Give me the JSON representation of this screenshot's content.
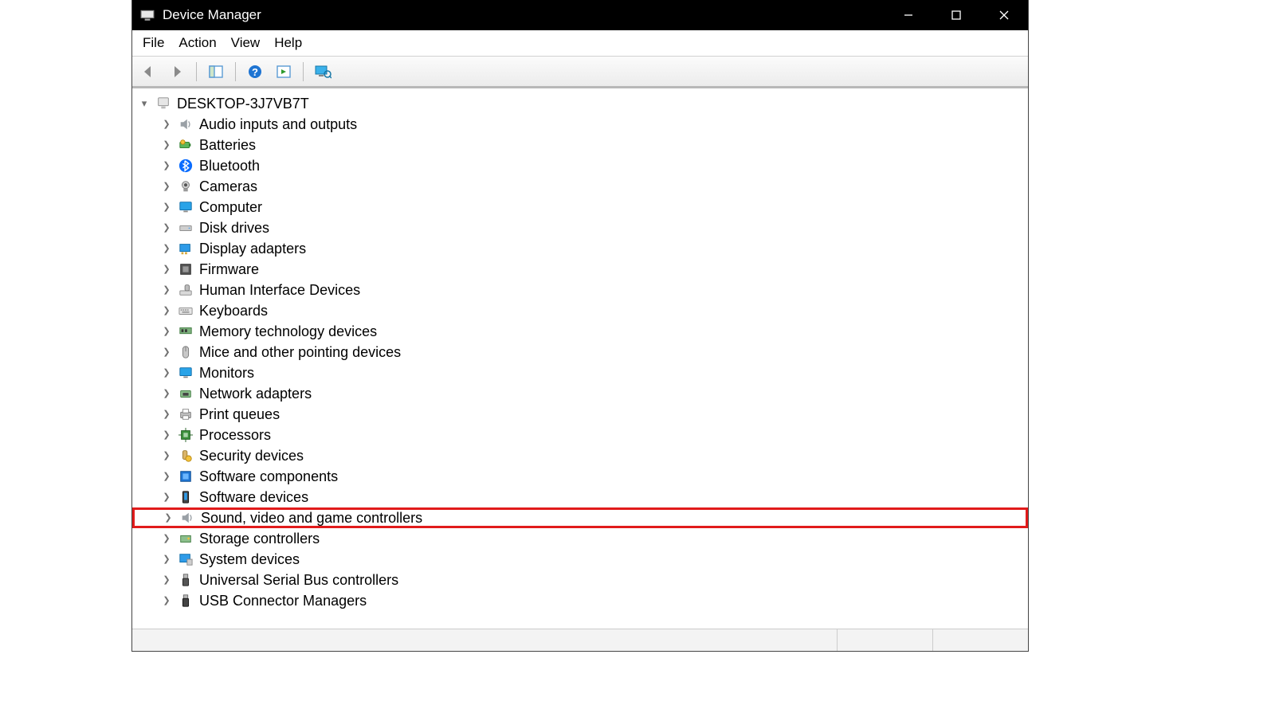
{
  "window": {
    "title": "Device Manager"
  },
  "menubar": {
    "items": [
      "File",
      "Action",
      "View",
      "Help"
    ]
  },
  "toolbar": {
    "items": [
      {
        "name": "back-icon"
      },
      {
        "name": "forward-icon"
      },
      {
        "name": "show-hide-tree-icon"
      },
      {
        "name": "help-icon"
      },
      {
        "name": "action-icon"
      },
      {
        "name": "scan-hardware-icon"
      }
    ]
  },
  "tree": {
    "root": {
      "label": "DESKTOP-3J7VB7T",
      "expanded": true,
      "icon": "computer-icon"
    },
    "categories": [
      {
        "label": "Audio inputs and outputs",
        "icon": "speaker-icon",
        "highlighted": false
      },
      {
        "label": "Batteries",
        "icon": "battery-icon",
        "highlighted": false
      },
      {
        "label": "Bluetooth",
        "icon": "bluetooth-icon",
        "highlighted": false
      },
      {
        "label": "Cameras",
        "icon": "camera-icon",
        "highlighted": false
      },
      {
        "label": "Computer",
        "icon": "monitor-icon",
        "highlighted": false
      },
      {
        "label": "Disk drives",
        "icon": "disk-icon",
        "highlighted": false
      },
      {
        "label": "Display adapters",
        "icon": "display-adapter-icon",
        "highlighted": false
      },
      {
        "label": "Firmware",
        "icon": "firmware-icon",
        "highlighted": false
      },
      {
        "label": "Human Interface Devices",
        "icon": "hid-icon",
        "highlighted": false
      },
      {
        "label": "Keyboards",
        "icon": "keyboard-icon",
        "highlighted": false
      },
      {
        "label": "Memory technology devices",
        "icon": "memory-icon",
        "highlighted": false
      },
      {
        "label": "Mice and other pointing devices",
        "icon": "mouse-icon",
        "highlighted": false
      },
      {
        "label": "Monitors",
        "icon": "monitor-icon",
        "highlighted": false
      },
      {
        "label": "Network adapters",
        "icon": "network-icon",
        "highlighted": false
      },
      {
        "label": "Print queues",
        "icon": "printer-icon",
        "highlighted": false
      },
      {
        "label": "Processors",
        "icon": "cpu-icon",
        "highlighted": false
      },
      {
        "label": "Security devices",
        "icon": "security-icon",
        "highlighted": false
      },
      {
        "label": "Software components",
        "icon": "software-component-icon",
        "highlighted": false
      },
      {
        "label": "Software devices",
        "icon": "software-device-icon",
        "highlighted": false
      },
      {
        "label": "Sound, video and game controllers",
        "icon": "sound-icon",
        "highlighted": true
      },
      {
        "label": "Storage controllers",
        "icon": "storage-icon",
        "highlighted": false
      },
      {
        "label": "System devices",
        "icon": "system-icon",
        "highlighted": false
      },
      {
        "label": "Universal Serial Bus controllers",
        "icon": "usb-icon",
        "highlighted": false
      },
      {
        "label": "USB Connector Managers",
        "icon": "usb-connector-icon",
        "highlighted": false
      }
    ]
  },
  "highlight_color": "#e11b1b"
}
